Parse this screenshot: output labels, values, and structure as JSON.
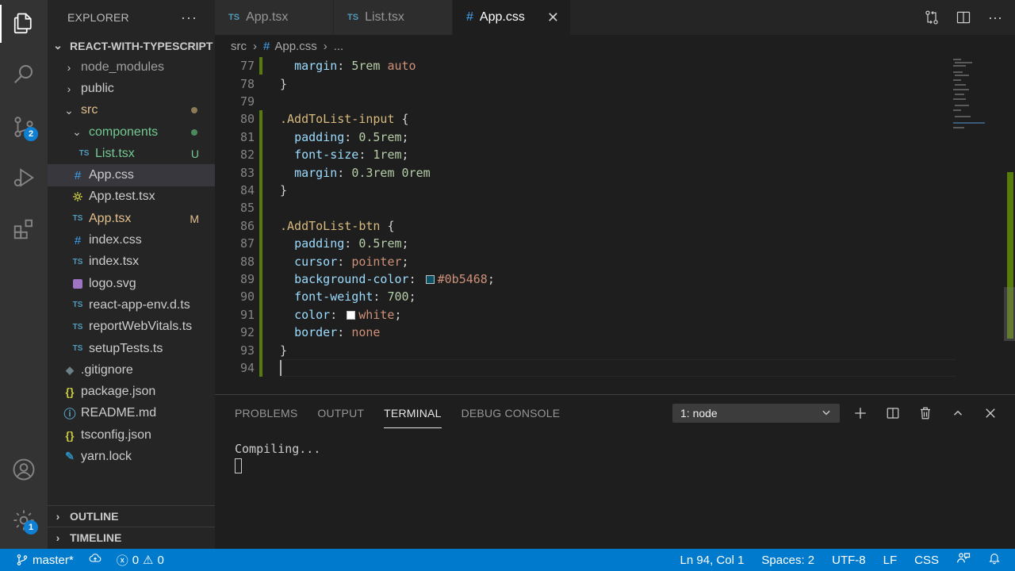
{
  "activity_bar": {
    "scm_badge": "2",
    "settings_badge": "1"
  },
  "sidebar": {
    "title": "EXPLORER",
    "more_actions": "···",
    "project": "REACT-WITH-TYPESCRIPT",
    "items": [
      {
        "label": "node_modules"
      },
      {
        "label": "public"
      },
      {
        "label": "src"
      },
      {
        "label": "components"
      },
      {
        "label": "List.tsx",
        "status": "U",
        "icon_text": "TS"
      },
      {
        "label": "App.css",
        "icon_text": "#"
      },
      {
        "label": "App.test.tsx"
      },
      {
        "label": "App.tsx",
        "status": "M",
        "icon_text": "TS"
      },
      {
        "label": "index.css",
        "icon_text": "#"
      },
      {
        "label": "index.tsx",
        "icon_text": "TS"
      },
      {
        "label": "logo.svg"
      },
      {
        "label": "react-app-env.d.ts",
        "icon_text": "TS"
      },
      {
        "label": "reportWebVitals.ts",
        "icon_text": "TS"
      },
      {
        "label": "setupTests.ts",
        "icon_text": "TS"
      },
      {
        "label": ".gitignore"
      },
      {
        "label": "package.json",
        "icon_text": "{}"
      },
      {
        "label": "README.md"
      },
      {
        "label": "tsconfig.json",
        "icon_text": "{}"
      },
      {
        "label": "yarn.lock"
      }
    ],
    "outline": "OUTLINE",
    "timeline": "TIMELINE"
  },
  "tabs": [
    {
      "label": "App.tsx",
      "icon_text": "TS"
    },
    {
      "label": "List.tsx",
      "icon_text": "TS"
    },
    {
      "label": "App.css",
      "icon_text": "#"
    }
  ],
  "breadcrumb": {
    "folder": "src",
    "file": "App.css",
    "more": "..."
  },
  "editor": {
    "lines": [
      {
        "n": "77",
        "text": "  margin: 5rem auto"
      },
      {
        "n": "78",
        "text": "}"
      },
      {
        "n": "79",
        "text": ""
      },
      {
        "n": "80",
        "text": ".AddToList-input {"
      },
      {
        "n": "81",
        "text": "  padding: 0.5rem;"
      },
      {
        "n": "82",
        "text": "  font-size: 1rem;"
      },
      {
        "n": "83",
        "text": "  margin: 0.3rem 0rem"
      },
      {
        "n": "84",
        "text": "}"
      },
      {
        "n": "85",
        "text": ""
      },
      {
        "n": "86",
        "text": ".AddToList-btn {"
      },
      {
        "n": "87",
        "text": "  padding: 0.5rem;"
      },
      {
        "n": "88",
        "text": "  cursor: pointer;"
      },
      {
        "n": "89",
        "text": "  background-color: #0b5468;"
      },
      {
        "n": "90",
        "text": "  font-weight: 700;"
      },
      {
        "n": "91",
        "text": "  color: white;"
      },
      {
        "n": "92",
        "text": "  border: none"
      },
      {
        "n": "93",
        "text": "}"
      },
      {
        "n": "94",
        "text": ""
      }
    ],
    "swatch_colors": {
      "bg": "#0b5468",
      "white": "#ffffff"
    }
  },
  "panel": {
    "tabs": [
      "PROBLEMS",
      "OUTPUT",
      "TERMINAL",
      "DEBUG CONSOLE"
    ],
    "active_tab": "TERMINAL",
    "terminal_select": "1: node",
    "terminal_output": "Compiling..."
  },
  "statusbar": {
    "branch": "master*",
    "errors": "0",
    "warnings": "0",
    "position": "Ln 94, Col 1",
    "spaces": "Spaces: 2",
    "encoding": "UTF-8",
    "eol": "LF",
    "language": "CSS"
  },
  "colors": {
    "accent": "#007acc",
    "modified": "#e2c08d",
    "untracked": "#73c991"
  }
}
